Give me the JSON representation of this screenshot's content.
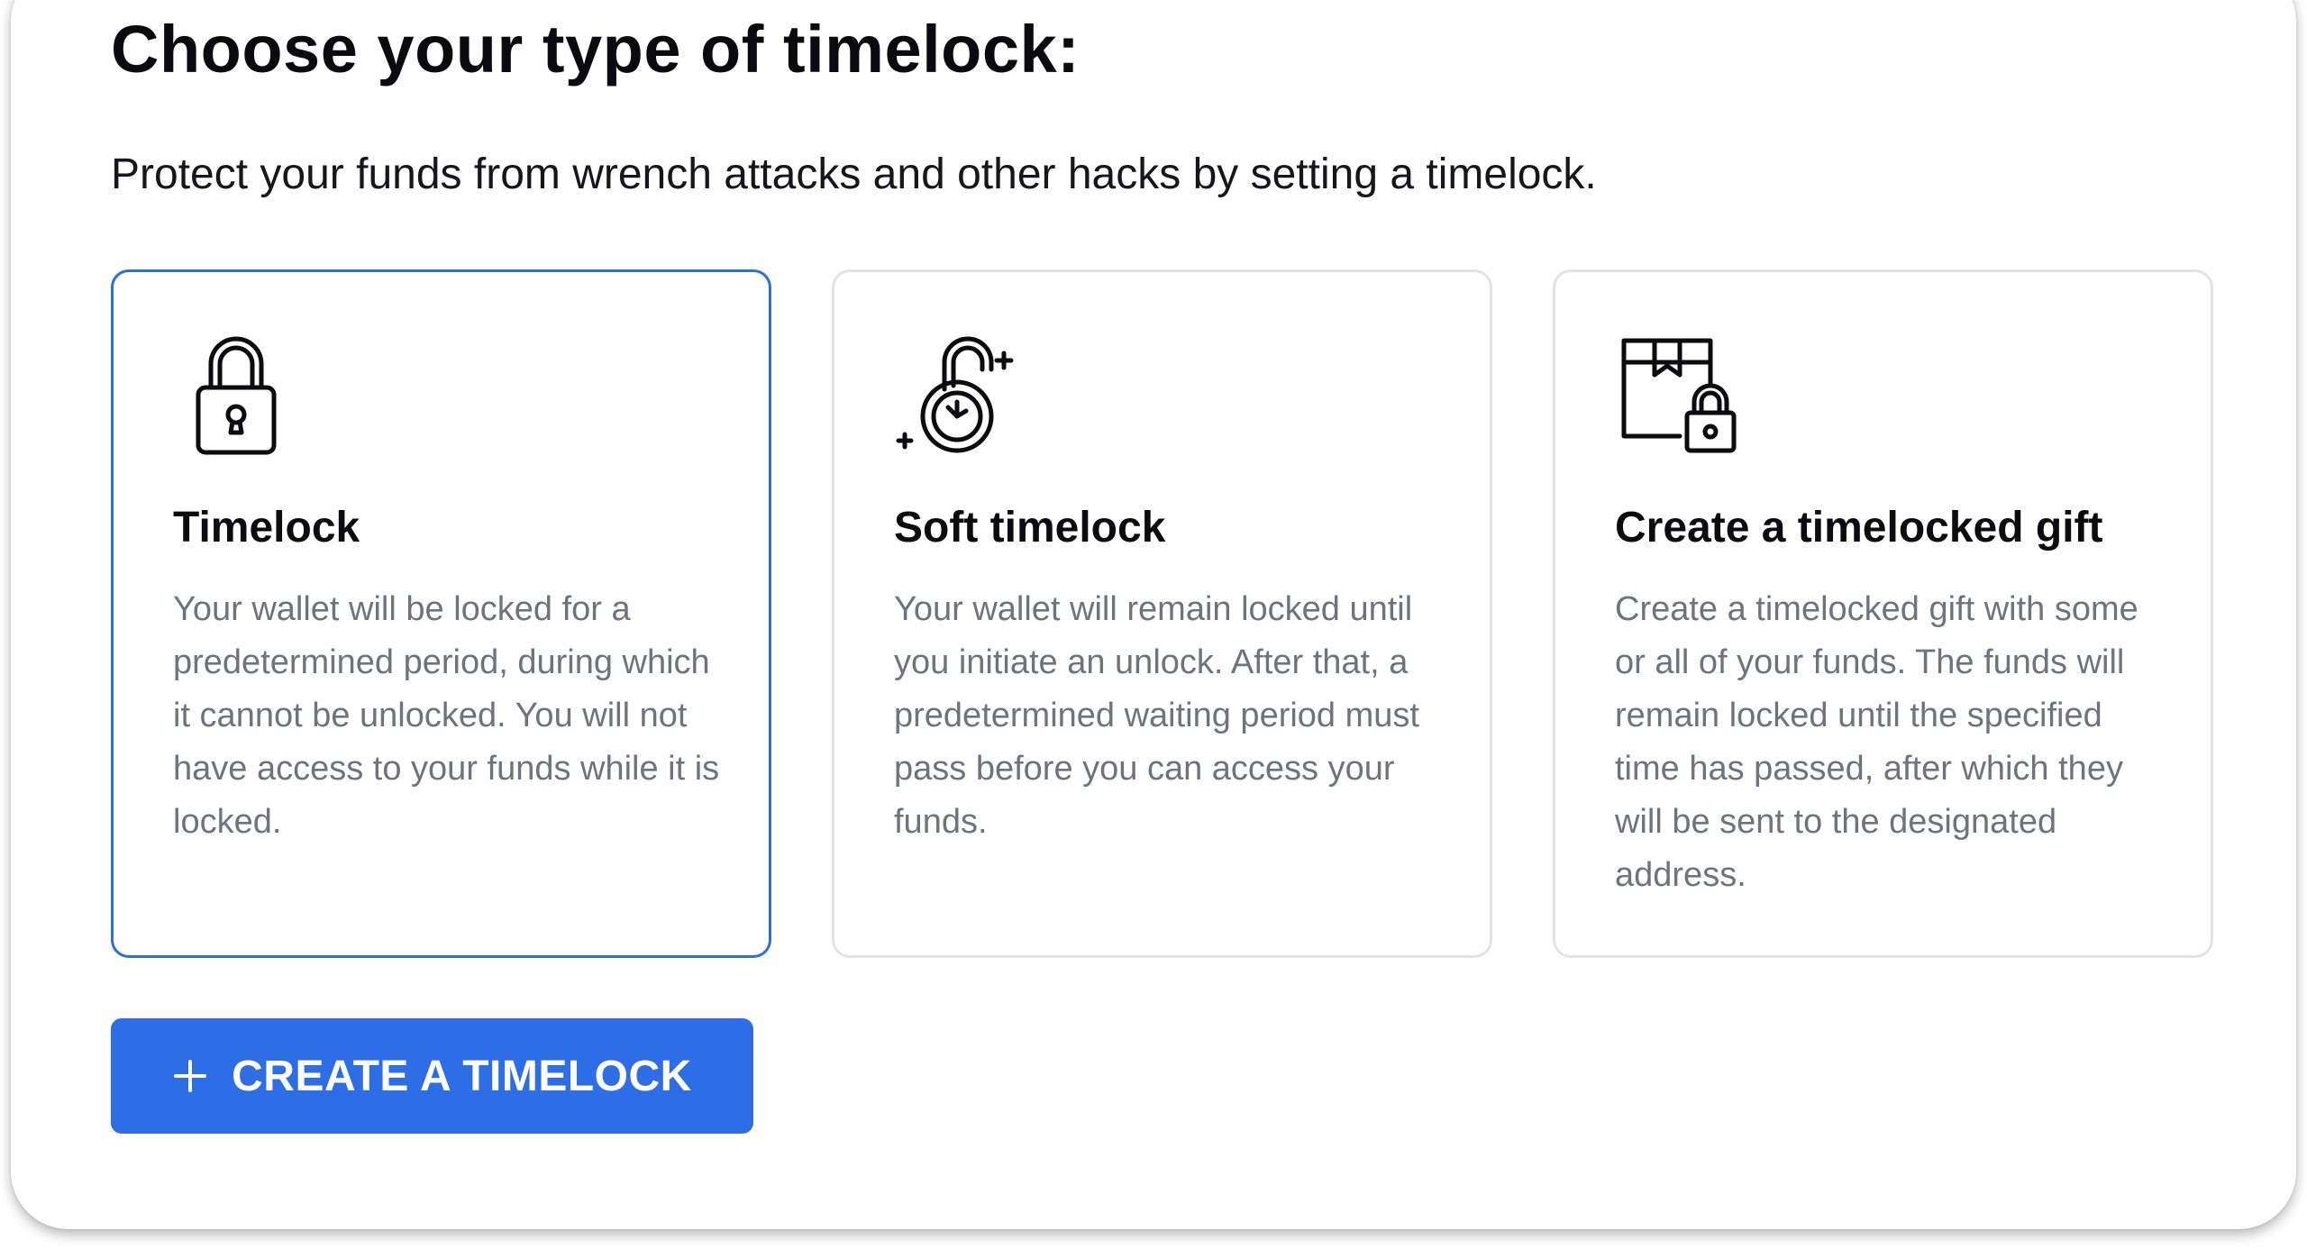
{
  "header": {
    "title": "Choose your type of timelock:",
    "subtitle": "Protect your funds from wrench attacks and other hacks by setting a timelock."
  },
  "options": [
    {
      "icon": "padlock-icon",
      "title": "Timelock",
      "description": "Your wallet will be locked for a predetermined period, during which it cannot be unlocked. You will not have access to your funds while it is locked.",
      "selected": true
    },
    {
      "icon": "timer-padlock-icon",
      "title": "Soft timelock",
      "description": "Your wallet will remain locked until you initiate an unlock. After that, a predetermined waiting period must pass before you can access your funds.",
      "selected": false
    },
    {
      "icon": "locked-gift-box-icon",
      "title": "Create a timelocked gift",
      "description": "Create a timelocked gift with some or all of your funds. The funds will remain locked until the specified time has passed, after which they will be sent to the designated address.",
      "selected": false
    }
  ],
  "action": {
    "icon": "plus-icon",
    "label": "CREATE A TIMELOCK"
  },
  "colors": {
    "accent": "#2d6ee6",
    "selected_border": "#2f6fdc",
    "card_border": "#e1e3e8",
    "description_text": "#6f737c"
  }
}
